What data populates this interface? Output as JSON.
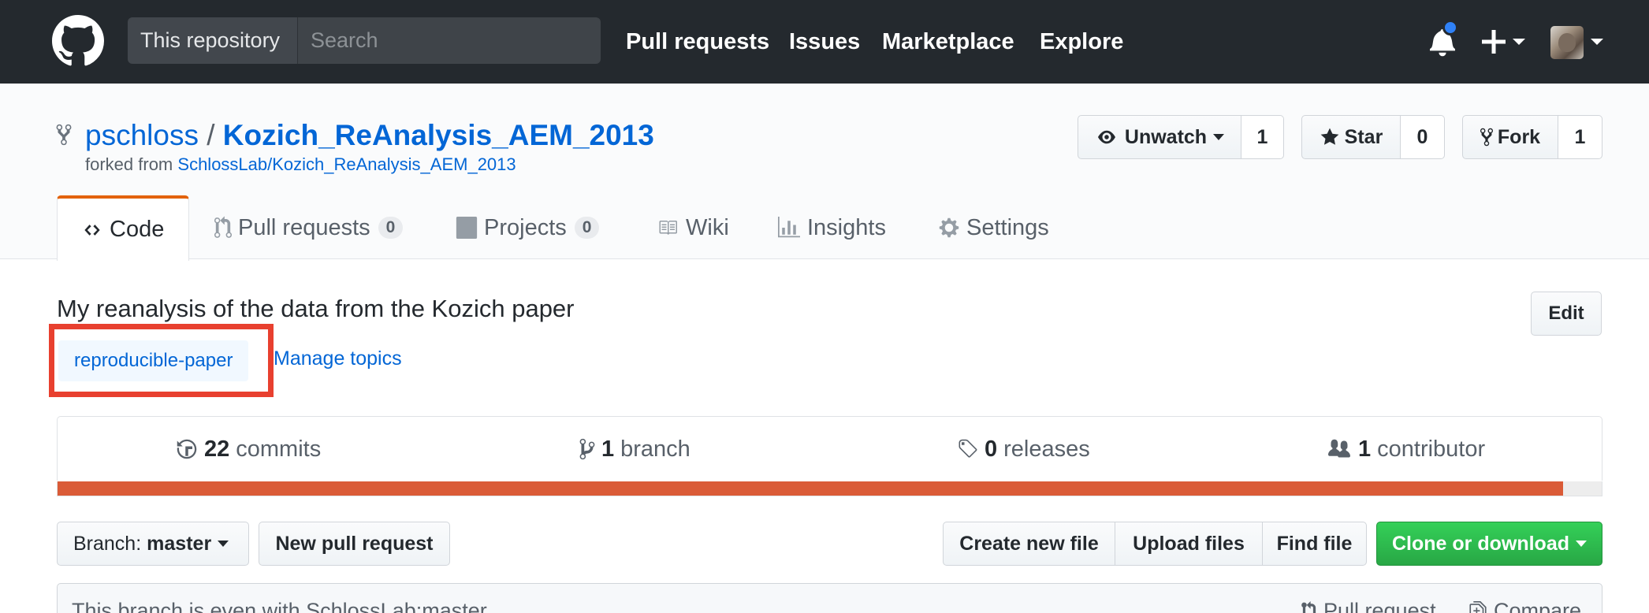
{
  "header": {
    "search_scope": "This repository",
    "search_placeholder": "Search",
    "nav": [
      "Pull requests",
      "Issues",
      "Marketplace",
      "Explore"
    ],
    "icons": [
      "github-logo-icon",
      "bell-icon",
      "plus-icon",
      "avatar"
    ],
    "notification_dot_color": "#2f81f7"
  },
  "repo": {
    "owner": "pschloss",
    "separator": "/",
    "name": "Kozich_ReAnalysis_AEM_2013",
    "forked_from_label": "forked from",
    "forked_from_repo": "SchlossLab/Kozich_ReAnalysis_AEM_2013",
    "actions": {
      "watch_label": "Unwatch",
      "watch_count": "1",
      "star_label": "Star",
      "star_count": "0",
      "fork_label": "Fork",
      "fork_count": "1"
    }
  },
  "tabs": [
    {
      "label": "Code",
      "selected": true
    },
    {
      "label": "Pull requests",
      "counter": "0"
    },
    {
      "label": "Projects",
      "counter": "0"
    },
    {
      "label": "Wiki"
    },
    {
      "label": "Insights"
    },
    {
      "label": "Settings"
    }
  ],
  "about": {
    "description": "My reanalysis of the data from the Kozich paper",
    "edit_label": "Edit",
    "topic": "reproducible-paper",
    "manage_topics": "Manage topics",
    "highlight_color": "#e8402f"
  },
  "summary": {
    "commits_num": "22",
    "commits_label": "commits",
    "branch_num": "1",
    "branch_label": "branch",
    "releases_num": "0",
    "releases_label": "releases",
    "contributors_num": "1",
    "contributors_label": "contributor",
    "language_bar": {
      "color": "#da5b37",
      "fraction": 0.975
    }
  },
  "file_nav": {
    "branch_prefix": "Branch:",
    "branch_name": "master",
    "new_pull_request": "New pull request",
    "create_new_file": "Create new file",
    "upload_files": "Upload files",
    "find_file": "Find file",
    "clone_or_download": "Clone or download"
  },
  "branch_info": {
    "status": "This branch is even with SchlossLab:master.",
    "pull_request": "Pull request",
    "compare": "Compare"
  },
  "colors": {
    "header_bg": "#24292e",
    "link": "#0366d6",
    "selected_tab_accent": "#e36209",
    "clone_button": "#28a745"
  }
}
